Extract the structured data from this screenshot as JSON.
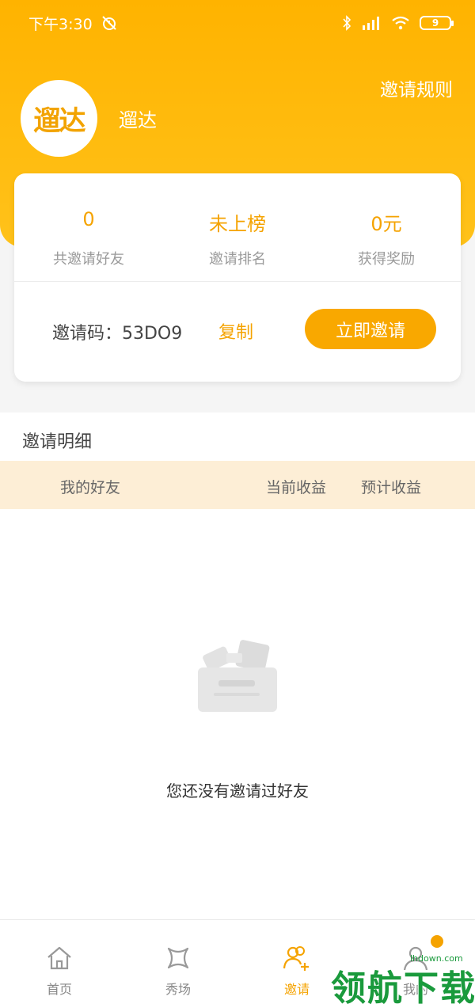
{
  "status_bar": {
    "time": "下午3:30",
    "battery": "9"
  },
  "header": {
    "rules_link": "邀请规则",
    "avatar_text": "遛达",
    "username": "遛达"
  },
  "stats": [
    {
      "value": "0",
      "label": "共邀请好友"
    },
    {
      "value": "未上榜",
      "label": "邀请排名"
    },
    {
      "value": "0元",
      "label": "获得奖励"
    }
  ],
  "invite": {
    "code_label": "邀请码：53DO9",
    "copy_label": "复制",
    "invite_button": "立即邀请"
  },
  "details": {
    "title": "邀请明细",
    "columns": [
      "我的好友",
      "当前收益",
      "预计收益"
    ],
    "empty_message": "您还没有邀请过好友"
  },
  "tabs": [
    {
      "label": "首页",
      "icon": "home-icon"
    },
    {
      "label": "秀场",
      "icon": "show-icon"
    },
    {
      "label": "邀请",
      "icon": "invite-icon",
      "active": true
    },
    {
      "label": "我的",
      "icon": "profile-icon"
    }
  ],
  "watermark": {
    "text": "领航下载",
    "url": "lhdown.com"
  },
  "colors": {
    "accent": "#f5a300",
    "header": "#ffb300",
    "watermark": "#1a9a3c"
  }
}
